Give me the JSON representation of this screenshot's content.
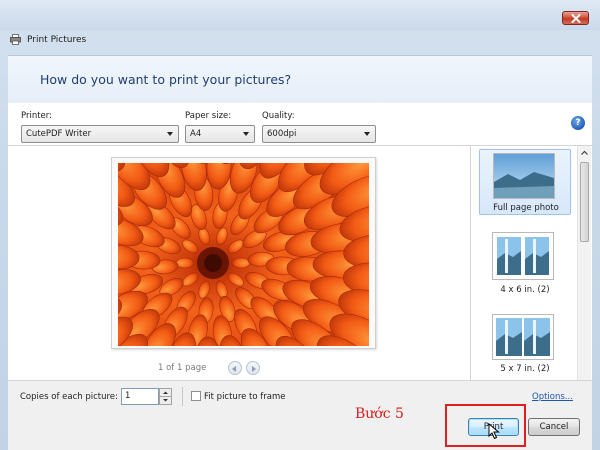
{
  "window": {
    "title": "Print Pictures"
  },
  "header": {
    "heading": "How do you want to print your pictures?"
  },
  "toolbar": {
    "printer_label": "Printer:",
    "printer_value": "CutePDF Writer",
    "paper_label": "Paper size:",
    "paper_value": "A4",
    "quality_label": "Quality:",
    "quality_value": "600dpi",
    "help_glyph": "?"
  },
  "preview": {
    "page_count": "1 of 1 page"
  },
  "layouts": [
    {
      "label": "Full page photo",
      "selected": true
    },
    {
      "label": "4 x 6 in. (2)",
      "selected": false
    },
    {
      "label": "5 x 7 in. (2)",
      "selected": false
    }
  ],
  "bottom": {
    "copies_label": "Copies of each picture:",
    "copies_value": "1",
    "fit_label": "Fit picture to frame",
    "fit_checked": false,
    "options_link": "Options..."
  },
  "footer": {
    "step_annotation": "Bước 5",
    "print_label": "Print",
    "cancel_label": "Cancel"
  },
  "colors": {
    "heading": "#1e3f73",
    "annotation": "#d91e1e",
    "link": "#1b56b2"
  },
  "icons": {
    "title": "printer-icon",
    "close": "close-icon",
    "help": "help-icon",
    "cursor": "mouse-pointer-icon"
  }
}
